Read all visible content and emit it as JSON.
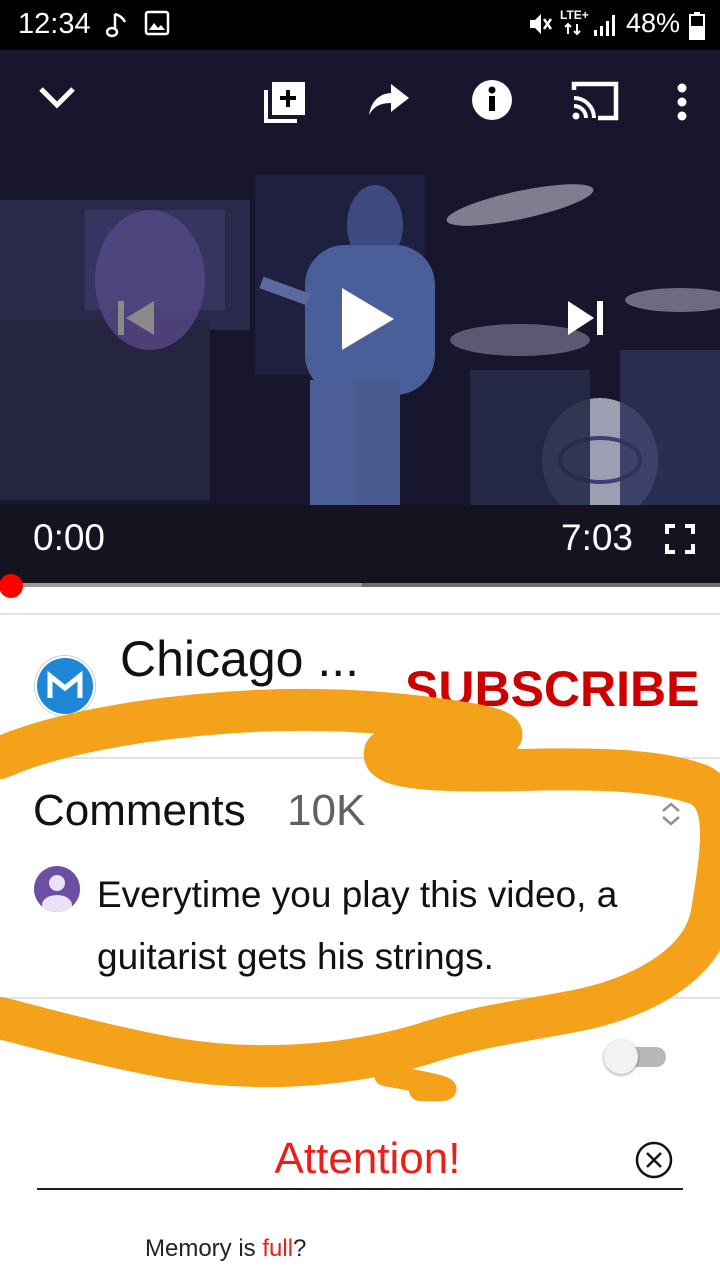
{
  "status_bar": {
    "time": "12:34",
    "lte_label": "LTE+",
    "battery_percent": "48%"
  },
  "player": {
    "current_time": "0:00",
    "duration": "7:03",
    "played_fraction": 0.0,
    "buffered_fraction": 0.5,
    "icons": [
      "collapse-chevron-icon",
      "add-to-playlist-icon",
      "share-icon",
      "info-icon",
      "cast-icon",
      "more-vert-icon",
      "previous-icon",
      "play-icon",
      "next-icon",
      "fullscreen-icon"
    ]
  },
  "channel": {
    "name": "Chicago ...",
    "subscribe_label": "SUBSCRIBE"
  },
  "comments": {
    "title": "Comments",
    "count": "10K",
    "top_comment": "Everytime you play this video, a guitarist gets his strings."
  },
  "up_next": {
    "autoplay_enabled": false
  },
  "overlay": {
    "scribble_color": "#f5a21b",
    "attention_title": "Attention!",
    "memory_prefix": "Memory is ",
    "memory_highlight": "full",
    "memory_suffix": "?",
    "accent_color": "#e8201c"
  },
  "colors": {
    "subscribe": "#cc0000",
    "progress_played": "#ff0000"
  }
}
